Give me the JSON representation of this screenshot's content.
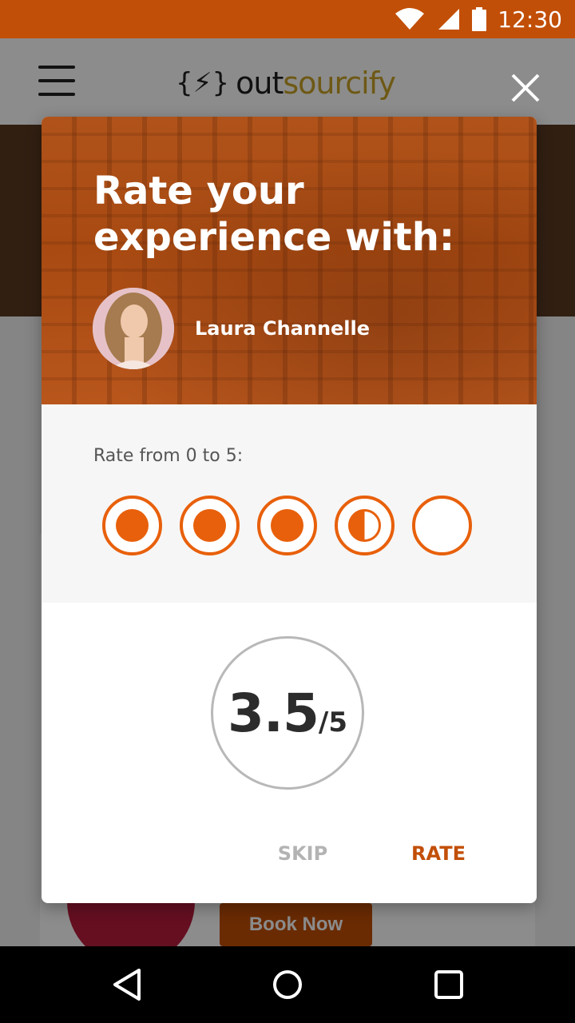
{
  "status_bar": {
    "time": "12:30",
    "icons": [
      "wifi-icon",
      "signal-icon",
      "battery-icon"
    ],
    "color": "#c24f07"
  },
  "app": {
    "logo": {
      "brace_text": "{⚡}",
      "name_part1": "out",
      "name_part2": "sourcify"
    },
    "book_button_label": "Book Now"
  },
  "modal": {
    "title": "Rate your experience with:",
    "profile_name": "Laura Channelle",
    "rate_label": "Rate from 0 to 5:",
    "rating_value": 3.5,
    "rating_max": 5,
    "score_text": "3.5",
    "score_max_text": "/5",
    "dots": [
      "full",
      "full",
      "full",
      "half",
      "empty"
    ],
    "skip_label": "SKIP",
    "rate_label_button": "RATE",
    "accent_color": "#e8600b"
  },
  "nav": {
    "icons": [
      "back-icon",
      "home-icon",
      "recents-icon"
    ]
  }
}
